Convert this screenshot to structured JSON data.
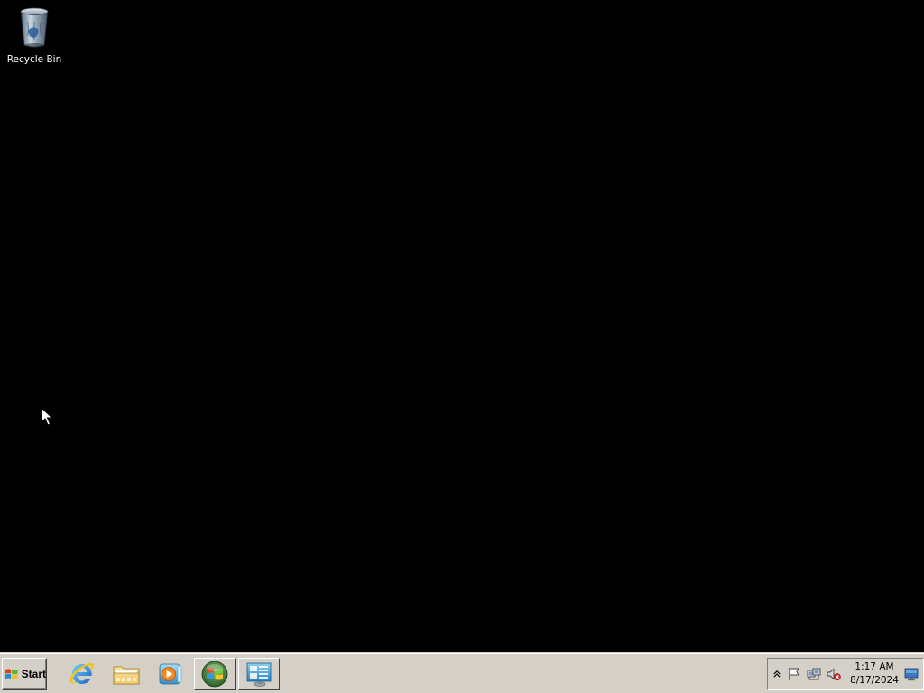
{
  "desktop": {
    "background_color": "#000000",
    "icons": [
      {
        "label": "Recycle Bin",
        "icon": "recycle-bin-icon"
      }
    ]
  },
  "taskbar": {
    "background_color": "#d4d0c8",
    "start_label": "Start",
    "quick_launch": [
      {
        "name": "internet-explorer",
        "icon": "internet-explorer-icon"
      },
      {
        "name": "windows-explorer",
        "icon": "folder-icon"
      },
      {
        "name": "windows-media-player",
        "icon": "media-player-icon"
      },
      {
        "name": "windows-update",
        "icon": "windows-logo-icon"
      },
      {
        "name": "server-manager",
        "icon": "server-manager-icon"
      }
    ],
    "tray_icons": [
      {
        "name": "action-center",
        "icon": "flag-icon"
      },
      {
        "name": "network",
        "icon": "network-icon"
      },
      {
        "name": "volume",
        "icon": "volume-muted-icon"
      }
    ]
  },
  "clock": {
    "time": "1:17 AM",
    "date": "8/17/2024"
  }
}
